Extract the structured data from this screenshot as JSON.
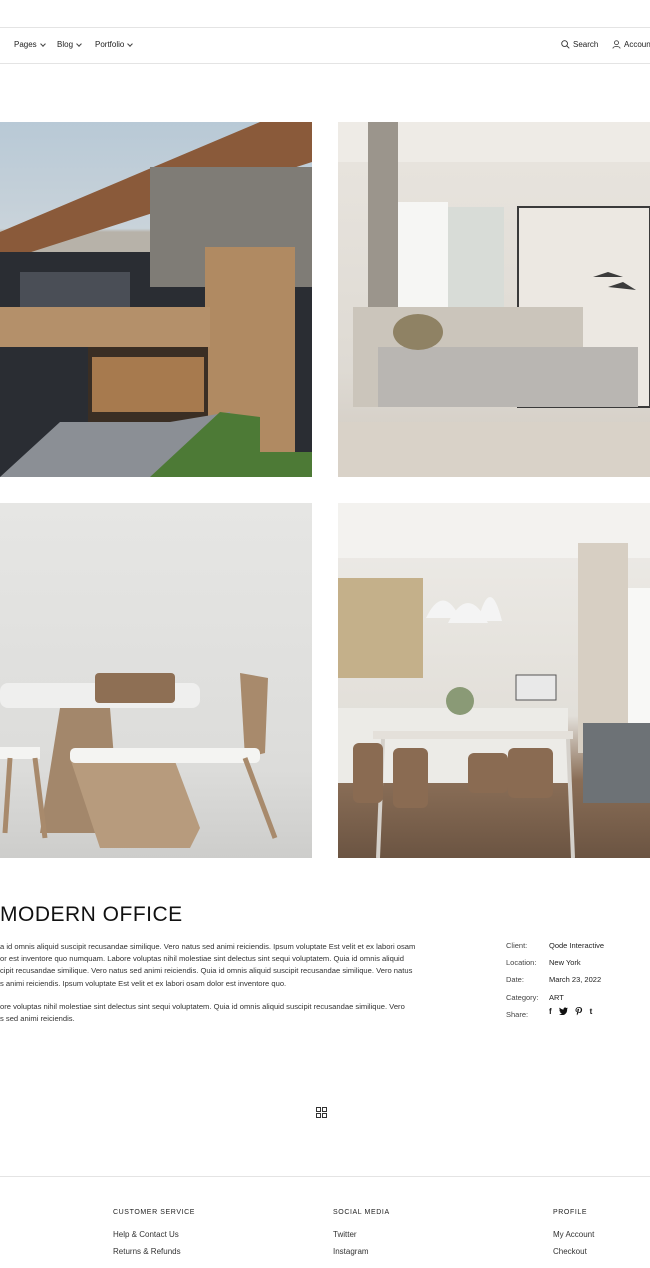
{
  "nav": {
    "pages": "Pages",
    "blog": "Blog",
    "portfolio": "Portfolio",
    "search": "Search",
    "account": "Accoun"
  },
  "gallery": [
    {
      "name": "house-exterior-photo"
    },
    {
      "name": "bedroom-photo"
    },
    {
      "name": "dining-chairs-photo"
    },
    {
      "name": "dining-room-photo"
    }
  ],
  "project": {
    "title": "MODERN OFFICE",
    "paragraph1": [
      "a id omnis aliquid suscipit recusandae similique. Vero natus sed animi reiciendis. Ipsum voluptate Est velit et ex labori osam",
      "or est inventore quo numquam. Labore voluptas nihil molestiae sint delectus sint sequi voluptatem. Quia id omnis aliquid",
      "cipit recusandae similique. Vero natus sed animi reiciendis. Quia id omnis aliquid suscipit recusandae similique. Vero natus",
      "s animi reiciendis. Ipsum voluptate Est velit et ex labori osam dolor est inventore quo."
    ],
    "paragraph2": [
      "ore voluptas nihil molestiae sint delectus sint sequi voluptatem. Quia id omnis aliquid suscipit recusandae similique. Vero",
      "s sed animi reiciendis."
    ]
  },
  "meta": {
    "client_label": "Client:",
    "client_value": "Qode Interactive",
    "location_label": "Location:",
    "location_value": "New York",
    "date_label": "Date:",
    "date_value": "March 23, 2022",
    "category_label": "Category:",
    "category_value": "ART",
    "share_label": "Share:",
    "share_icons": [
      "facebook-icon",
      "twitter-icon",
      "pinterest-icon",
      "tumblr-icon"
    ]
  },
  "footer": {
    "customer_service": {
      "heading": "CUSTOMER SERVICE",
      "links": [
        "Help & Contact Us",
        "Returns & Refunds"
      ]
    },
    "social_media": {
      "heading": "SOCIAL MEDIA",
      "links": [
        "Twitter",
        "Instagram"
      ]
    },
    "profile": {
      "heading": "PROFILE",
      "links": [
        "My Account",
        "Checkout"
      ]
    }
  }
}
